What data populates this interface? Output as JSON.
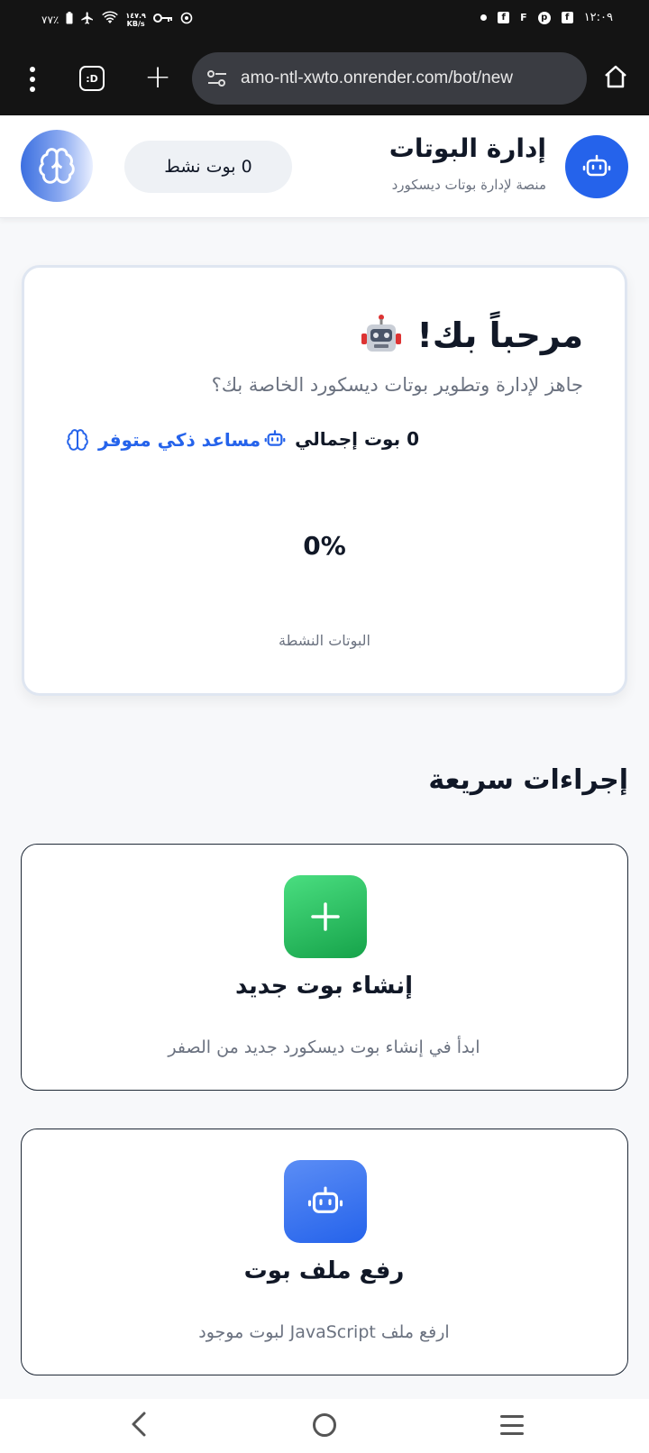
{
  "status_bar": {
    "battery": "٧٧٪",
    "speed_top": "١٤٧.٩",
    "speed_unit": "KB/s",
    "time": "١٢:٠٩"
  },
  "browser": {
    "tabs_label": ":D",
    "url": "amo-ntl-xwto.onrender.com/bot/new"
  },
  "header": {
    "title": "إدارة البوتات",
    "subtitle": "منصة لإدارة بوتات ديسكورد",
    "active_pill": "0 بوت نشط"
  },
  "welcome": {
    "title": "مرحباً بك!",
    "subtitle": "جاهز لإدارة وتطوير بوتات ديسكورد الخاصة بك؟",
    "total_bots": "0 بوت إجمالي",
    "ai_available": "مساعد ذكي متوفر",
    "active_percent": "0%",
    "active_label": "البوتات النشطة"
  },
  "quick_actions": {
    "title": "إجراءات سريعة",
    "items": [
      {
        "title": "إنشاء بوت جديد",
        "description": "ابدأ في إنشاء بوت ديسكورد جديد من الصفر",
        "icon": "plus-icon",
        "color": "#22c55e"
      },
      {
        "title": "رفع ملف بوت",
        "description": "ارفع ملف JavaScript لبوت موجود",
        "icon": "robot-icon",
        "color": "#2563eb"
      }
    ]
  },
  "colors": {
    "primary": "#2563eb",
    "success": "#22c55e",
    "text": "#111827",
    "muted": "#6b7280"
  }
}
